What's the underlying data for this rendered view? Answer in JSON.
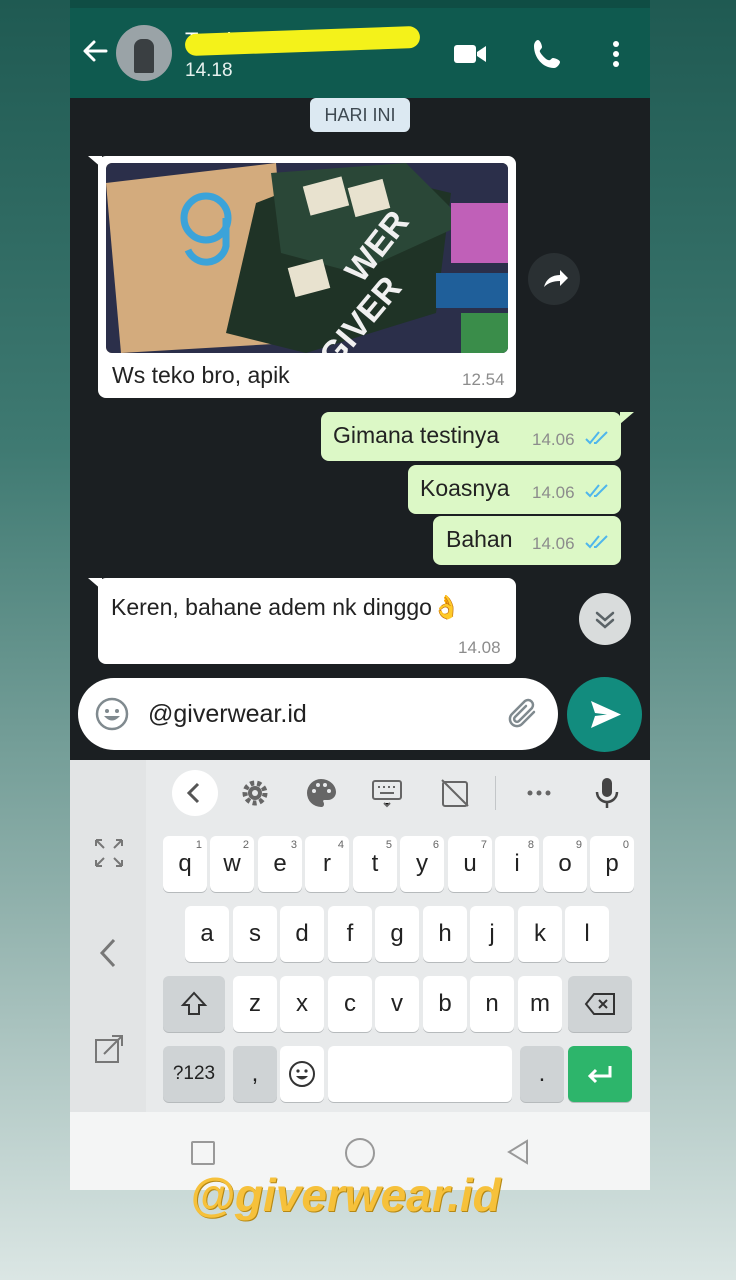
{
  "header": {
    "contact_name": "Te ek Ar",
    "last_seen": "14.18",
    "icons": [
      "back-arrow-icon",
      "video-call-icon",
      "phone-icon",
      "more-vert-icon"
    ]
  },
  "chat": {
    "day_label": "HARI INI",
    "messages": [
      {
        "direction": "in",
        "type": "image",
        "caption": "Ws teko bro, apik",
        "time": "12.54"
      },
      {
        "direction": "out",
        "text": "Gimana testinya",
        "time": "14.06",
        "status": "read"
      },
      {
        "direction": "out",
        "text": "Koasnya",
        "time": "14.06",
        "status": "read"
      },
      {
        "direction": "out",
        "text": "Bahan",
        "time": "14.06",
        "status": "read"
      },
      {
        "direction": "in",
        "text": "Keren, bahane adem nk dinggo👌",
        "time": "14.08"
      }
    ],
    "photo_text": [
      "GIVER",
      "WER"
    ]
  },
  "composer": {
    "value": "@giverwear.id"
  },
  "keyboard": {
    "row1": [
      {
        "k": "q",
        "h": "1"
      },
      {
        "k": "w",
        "h": "2"
      },
      {
        "k": "e",
        "h": "3"
      },
      {
        "k": "r",
        "h": "4"
      },
      {
        "k": "t",
        "h": "5"
      },
      {
        "k": "y",
        "h": "6"
      },
      {
        "k": "u",
        "h": "7"
      },
      {
        "k": "i",
        "h": "8"
      },
      {
        "k": "o",
        "h": "9"
      },
      {
        "k": "p",
        "h": "0"
      }
    ],
    "row2": [
      "a",
      "s",
      "d",
      "f",
      "g",
      "h",
      "j",
      "k",
      "l"
    ],
    "row3": [
      "z",
      "x",
      "c",
      "v",
      "b",
      "n",
      "m"
    ],
    "symbols_key": "?123",
    "comma_key": ",",
    "period_key": "."
  },
  "colors": {
    "header": "#0f5a4f",
    "outgoing": "#dcf8c6",
    "incoming": "#ffffff",
    "send": "#128c7e",
    "enter": "#2db56b",
    "ticks": "#4fb6ec",
    "watermark": "#f6c13b"
  },
  "watermark": "@giverwear.id"
}
